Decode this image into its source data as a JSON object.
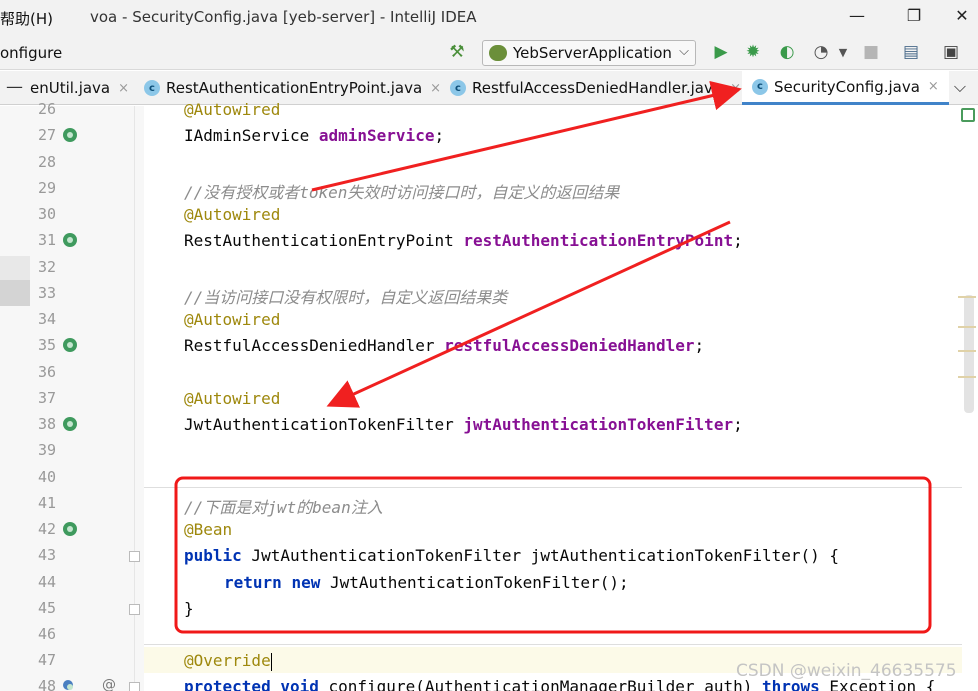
{
  "window": {
    "menu_fragment": "帮助(H)",
    "title": "voa - SecurityConfig.java [yeb-server] - IntelliJ IDEA",
    "minimize_glyph": "—",
    "maximize_glyph": "❐",
    "close_glyph": "✕"
  },
  "toolbar": {
    "breadcrumb_fragment": "onfigure",
    "run_config": "YebServerApplication",
    "run_config_chevron": "⌵"
  },
  "tabs": [
    {
      "label": "enUtil.java",
      "has_icon": false,
      "active": false
    },
    {
      "label": "RestAuthenticationEntryPoint.java",
      "has_icon": true,
      "active": false
    },
    {
      "label": "RestfulAccessDeniedHandler.java",
      "has_icon": true,
      "active": false
    },
    {
      "label": "SecurityConfig.java",
      "has_icon": true,
      "active": true
    }
  ],
  "tab_class_glyph": "c",
  "tab_close_glyph": "×",
  "tabs_more_glyph": "⌵",
  "tabs_minus_glyph": "—",
  "gutter": {
    "line_numbers": [
      "26",
      "27",
      "28",
      "29",
      "30",
      "31",
      "32",
      "33",
      "34",
      "35",
      "36",
      "37",
      "38",
      "39",
      "40",
      "41",
      "42",
      "43",
      "44",
      "45",
      "46",
      "47",
      "48"
    ],
    "at_glyph": "@"
  },
  "code": {
    "l26": "@Autowired",
    "l27_type": "IAdminService ",
    "l27_field": "adminService",
    "l27_end": ";",
    "l29": "//没有授权或者token失效时访问接口时，自定义的返回结果",
    "l30": "@Autowired",
    "l31_type": "RestAuthenticationEntryPoint ",
    "l31_field": "restAuthenticationEntryPoint",
    "l31_end": ";",
    "l33": "//当访问接口没有权限时，自定义返回结果类",
    "l34": "@Autowired",
    "l35_type": "RestfulAccessDeniedHandler ",
    "l35_field": "restfulAccessDeniedHandler",
    "l35_end": ";",
    "l37": "@Autowired",
    "l38_type": "JwtAuthenticationTokenFilter ",
    "l38_field": "jwtAuthenticationTokenFilter",
    "l38_end": ";",
    "l41": "//下面是对jwt的bean注入",
    "l42": "@Bean",
    "l43_kw": "public",
    "l43_rest": " JwtAuthenticationTokenFilter jwtAuthenticationTokenFilter() {",
    "l44_kw1": "return",
    "l44_kw2": "new",
    "l44_rest": " JwtAuthenticationTokenFilter();",
    "l45": "}",
    "l47": "@Override",
    "l48_kw1": "protected",
    "l48_kw2": "void",
    "l48_rest": " configure(AuthenticationManagerBuilder auth) ",
    "l48_kw3": "throws",
    "l48_tail": " Exception {"
  },
  "watermark": "CSDN @weixin_46635575",
  "colors": {
    "annotation_arrow": "#f02020",
    "highlight_box": "#f01818",
    "active_tab_underline": "#4083c9",
    "run_green": "#3a9a4a"
  }
}
